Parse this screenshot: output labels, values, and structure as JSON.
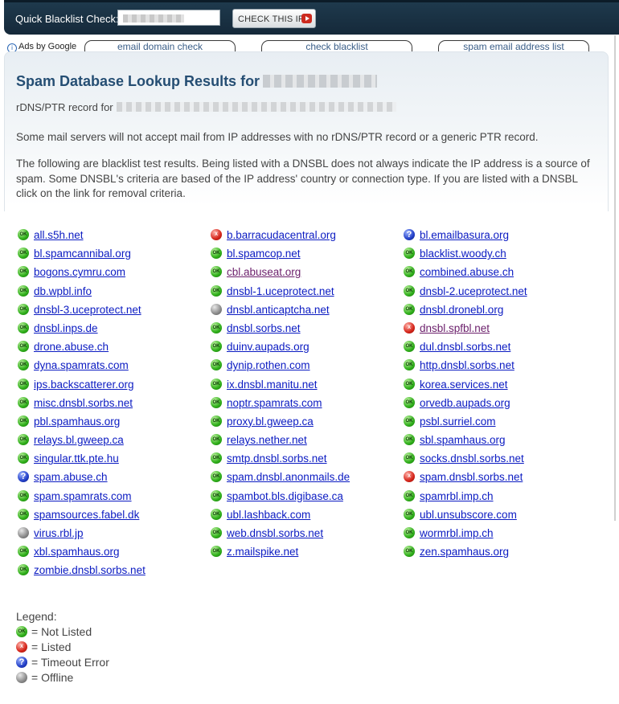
{
  "topbar": {
    "label": "Quick Blacklist Check:",
    "button": "CHECK THIS IP"
  },
  "ads": {
    "label": "Ads by Google",
    "links": [
      "email domain check",
      "check blacklist",
      "spam email address list"
    ]
  },
  "header": {
    "title": "Spam Database Lookup Results for",
    "rdns_label": "rDNS/PTR record for"
  },
  "notes": {
    "p1": "Some mail servers will not accept mail from IP addresses with no rDNS/PTR record or a generic PTR record.",
    "p2": "The following are blacklist test results. Being listed with a DNSBL does not always indicate the IP address is a source of spam. Some DNSBL's criteria are based of the IP address' country or connection type. If you are listed with a DNSBL click on the link for removal criteria."
  },
  "status_icons": {
    "ok": "OK",
    "listed": "X",
    "timeout": "?",
    "offline": ""
  },
  "columns": [
    [
      {
        "name": "all.s5h.net",
        "status": "ok"
      },
      {
        "name": "bl.spamcannibal.org",
        "status": "ok"
      },
      {
        "name": "bogons.cymru.com",
        "status": "ok"
      },
      {
        "name": "db.wpbl.info",
        "status": "ok"
      },
      {
        "name": "dnsbl-3.uceprotect.net",
        "status": "ok"
      },
      {
        "name": "dnsbl.inps.de",
        "status": "ok"
      },
      {
        "name": "drone.abuse.ch",
        "status": "ok"
      },
      {
        "name": "dyna.spamrats.com",
        "status": "ok"
      },
      {
        "name": "ips.backscatterer.org",
        "status": "ok"
      },
      {
        "name": "misc.dnsbl.sorbs.net",
        "status": "ok"
      },
      {
        "name": "pbl.spamhaus.org",
        "status": "ok"
      },
      {
        "name": "relays.bl.gweep.ca",
        "status": "ok"
      },
      {
        "name": "singular.ttk.pte.hu",
        "status": "ok"
      },
      {
        "name": "spam.abuse.ch",
        "status": "timeout"
      },
      {
        "name": "spam.spamrats.com",
        "status": "ok"
      },
      {
        "name": "spamsources.fabel.dk",
        "status": "ok"
      },
      {
        "name": "virus.rbl.jp",
        "status": "offline"
      },
      {
        "name": "xbl.spamhaus.org",
        "status": "ok"
      },
      {
        "name": "zombie.dnsbl.sorbs.net",
        "status": "ok"
      }
    ],
    [
      {
        "name": "b.barracudacentral.org",
        "status": "listed"
      },
      {
        "name": "bl.spamcop.net",
        "status": "ok"
      },
      {
        "name": "cbl.abuseat.org",
        "status": "ok",
        "visited": true
      },
      {
        "name": "dnsbl-1.uceprotect.net",
        "status": "ok"
      },
      {
        "name": "dnsbl.anticaptcha.net",
        "status": "offline"
      },
      {
        "name": "dnsbl.sorbs.net",
        "status": "ok"
      },
      {
        "name": "duinv.aupads.org",
        "status": "ok"
      },
      {
        "name": "dynip.rothen.com",
        "status": "ok"
      },
      {
        "name": "ix.dnsbl.manitu.net",
        "status": "ok"
      },
      {
        "name": "noptr.spamrats.com",
        "status": "ok"
      },
      {
        "name": "proxy.bl.gweep.ca",
        "status": "ok"
      },
      {
        "name": "relays.nether.net",
        "status": "ok"
      },
      {
        "name": "smtp.dnsbl.sorbs.net",
        "status": "ok"
      },
      {
        "name": "spam.dnsbl.anonmails.de",
        "status": "ok"
      },
      {
        "name": "spambot.bls.digibase.ca",
        "status": "ok"
      },
      {
        "name": "ubl.lashback.com",
        "status": "ok"
      },
      {
        "name": "web.dnsbl.sorbs.net",
        "status": "ok"
      },
      {
        "name": "z.mailspike.net",
        "status": "ok"
      }
    ],
    [
      {
        "name": "bl.emailbasura.org",
        "status": "timeout"
      },
      {
        "name": "blacklist.woody.ch",
        "status": "ok"
      },
      {
        "name": "combined.abuse.ch",
        "status": "ok"
      },
      {
        "name": "dnsbl-2.uceprotect.net",
        "status": "ok"
      },
      {
        "name": "dnsbl.dronebl.org",
        "status": "ok"
      },
      {
        "name": "dnsbl.spfbl.net",
        "status": "listed",
        "visited": true
      },
      {
        "name": "dul.dnsbl.sorbs.net",
        "status": "ok"
      },
      {
        "name": "http.dnsbl.sorbs.net",
        "status": "ok"
      },
      {
        "name": "korea.services.net",
        "status": "ok"
      },
      {
        "name": "orvedb.aupads.org",
        "status": "ok"
      },
      {
        "name": "psbl.surriel.com",
        "status": "ok"
      },
      {
        "name": "sbl.spamhaus.org",
        "status": "ok"
      },
      {
        "name": "socks.dnsbl.sorbs.net",
        "status": "ok"
      },
      {
        "name": "spam.dnsbl.sorbs.net",
        "status": "listed"
      },
      {
        "name": "spamrbl.imp.ch",
        "status": "ok"
      },
      {
        "name": "ubl.unsubscore.com",
        "status": "ok"
      },
      {
        "name": "wormrbl.imp.ch",
        "status": "ok"
      },
      {
        "name": "zen.spamhaus.org",
        "status": "ok"
      }
    ]
  ],
  "legend": {
    "title": "Legend:",
    "items": [
      {
        "status": "ok",
        "label": "= Not Listed"
      },
      {
        "status": "listed",
        "label": "= Listed"
      },
      {
        "status": "timeout",
        "label": "= Timeout Error"
      },
      {
        "status": "offline",
        "label": "= Offline"
      }
    ]
  }
}
